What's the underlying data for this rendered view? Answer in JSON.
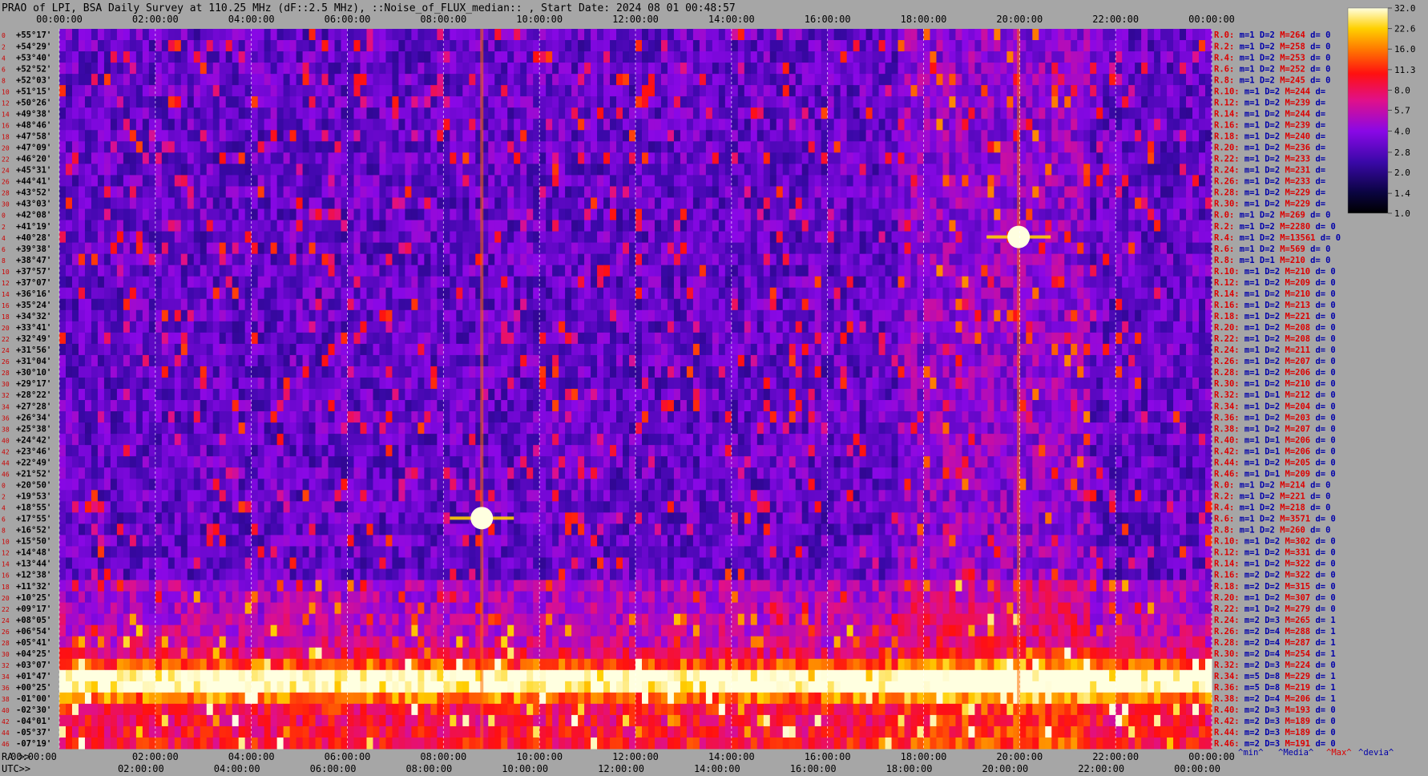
{
  "chart_data": {
    "type": "heatmap",
    "title": "PRAO of LPI, BSA Daily Survey at 110.25 MHz (dF::2.5 MHz), ::Noise_of_FLUX_median:: , Start Date: 2024 08 01 00:48:57",
    "ra_label": "RA >>",
    "utc_label": "UTC>>",
    "top_ticks": [
      "00:00:00",
      "02:00:00",
      "04:00:00",
      "06:00:00",
      "08:00:00",
      "10:00:00",
      "12:00:00",
      "14:00:00",
      "16:00:00",
      "18:00:00",
      "20:00:00",
      "22:00:00",
      "00:00:00"
    ],
    "ra_ticks": [
      "00:00:00",
      "02:00:00",
      "04:00:00",
      "06:00:00",
      "08:00:00",
      "10:00:00",
      "12:00:00",
      "14:00:00",
      "16:00:00",
      "18:00:00",
      "20:00:00",
      "22:00:00",
      "00:00:00"
    ],
    "utc_ticks": [
      "02:00:00",
      "04:00:00",
      "06:00:00",
      "08:00:00",
      "10:00:00",
      "12:00:00",
      "14:00:00",
      "16:00:00",
      "18:00:00",
      "20:00:00",
      "22:00:00",
      "00:00:00"
    ],
    "declinations": [
      "+55°17'",
      "+54°29'",
      "+53°40'",
      "+52°52'",
      "+52°03'",
      "+51°15'",
      "+50°26'",
      "+49°38'",
      "+48°46'",
      "+47°58'",
      "+47°09'",
      "+46°20'",
      "+45°31'",
      "+44°41'",
      "+43°52'",
      "+43°03'",
      "+42°08'",
      "+41°19'",
      "+40°28'",
      "+39°38'",
      "+38°47'",
      "+37°57'",
      "+37°07'",
      "+36°16'",
      "+35°24'",
      "+34°32'",
      "+33°41'",
      "+32°49'",
      "+31°56'",
      "+31°04'",
      "+30°10'",
      "+29°17'",
      "+28°22'",
      "+27°28'",
      "+26°34'",
      "+25°38'",
      "+24°42'",
      "+23°46'",
      "+22°49'",
      "+21°52'",
      "+20°50'",
      "+19°53'",
      "+18°55'",
      "+17°55'",
      "+16°52'",
      "+15°50'",
      "+14°48'",
      "+13°44'",
      "+12°38'",
      "+11°32'",
      "+10°25'",
      "+09°17'",
      "+08°05'",
      "+06°54'",
      "+05°41'",
      "+04°25'",
      "+03°07'",
      "+01°47'",
      "+00°25'",
      "-01°00'",
      "-02°30'",
      "-04°01'",
      "-05°37'",
      "-07°19'"
    ],
    "row_indices": [
      "0",
      "2",
      "4",
      "6",
      "8",
      "10",
      "12",
      "14",
      "16",
      "18",
      "20",
      "22",
      "24",
      "26",
      "28",
      "30",
      "0",
      "2",
      "4",
      "6",
      "8",
      "10",
      "12",
      "14",
      "16",
      "18",
      "20",
      "22",
      "24",
      "26",
      "28",
      "30",
      "32",
      "34",
      "36",
      "38",
      "40",
      "42",
      "44",
      "46",
      "0",
      "2",
      "4",
      "6",
      "8",
      "10",
      "12",
      "14",
      "16",
      "18",
      "20",
      "22",
      "24",
      "26",
      "28",
      "30",
      "32",
      "34",
      "36",
      "38",
      "40",
      "42",
      "44",
      "46"
    ],
    "stats": [
      {
        "r": "R.0:",
        "m": "m=1",
        "d": "D=2",
        "M": "M=264",
        "dev": "d= 0"
      },
      {
        "r": "R.2:",
        "m": "m=1",
        "d": "D=2",
        "M": "M=258",
        "dev": "d= 0"
      },
      {
        "r": "R.4:",
        "m": "m=1",
        "d": "D=2",
        "M": "M=253",
        "dev": "d= 0"
      },
      {
        "r": "R.6:",
        "m": "m=1",
        "d": "D=2",
        "M": "M=252",
        "dev": "d= 0"
      },
      {
        "r": "R.8:",
        "m": "m=1",
        "d": "D=2",
        "M": "M=245",
        "dev": "d= 0"
      },
      {
        "r": "R.10:",
        "m": "m=1",
        "d": "D=2",
        "M": "M=244",
        "dev": "d="
      },
      {
        "r": "R.12:",
        "m": "m=1",
        "d": "D=2",
        "M": "M=239",
        "dev": "d="
      },
      {
        "r": "R.14:",
        "m": "m=1",
        "d": "D=2",
        "M": "M=244",
        "dev": "d="
      },
      {
        "r": "R.16:",
        "m": "m=1",
        "d": "D=2",
        "M": "M=239",
        "dev": "d="
      },
      {
        "r": "R.18:",
        "m": "m=1",
        "d": "D=2",
        "M": "M=240",
        "dev": "d="
      },
      {
        "r": "R.20:",
        "m": "m=1",
        "d": "D=2",
        "M": "M=236",
        "dev": "d="
      },
      {
        "r": "R.22:",
        "m": "m=1",
        "d": "D=2",
        "M": "M=233",
        "dev": "d="
      },
      {
        "r": "R.24:",
        "m": "m=1",
        "d": "D=2",
        "M": "M=231",
        "dev": "d="
      },
      {
        "r": "R.26:",
        "m": "m=1",
        "d": "D=2",
        "M": "M=233",
        "dev": "d="
      },
      {
        "r": "R.28:",
        "m": "m=1",
        "d": "D=2",
        "M": "M=229",
        "dev": "d="
      },
      {
        "r": "R.30:",
        "m": "m=1",
        "d": "D=2",
        "M": "M=229",
        "dev": "d="
      },
      {
        "r": "R.0:",
        "m": "m=1",
        "d": "D=2",
        "M": "M=269",
        "dev": "d= 0"
      },
      {
        "r": "R.2:",
        "m": "m=1",
        "d": "D=2",
        "M": "M=2280",
        "dev": "d= 0"
      },
      {
        "r": "R.4:",
        "m": "m=1",
        "d": "D=2",
        "M": "M=13561",
        "dev": "d= 0"
      },
      {
        "r": "R.6:",
        "m": "m=1",
        "d": "D=2",
        "M": "M=569",
        "dev": "d= 0"
      },
      {
        "r": "R.8:",
        "m": "m=1",
        "d": "D=1",
        "M": "M=210",
        "dev": "d= 0"
      },
      {
        "r": "R.10:",
        "m": "m=1",
        "d": "D=2",
        "M": "M=210",
        "dev": "d= 0"
      },
      {
        "r": "R.12:",
        "m": "m=1",
        "d": "D=2",
        "M": "M=209",
        "dev": "d= 0"
      },
      {
        "r": "R.14:",
        "m": "m=1",
        "d": "D=2",
        "M": "M=210",
        "dev": "d= 0"
      },
      {
        "r": "R.16:",
        "m": "m=1",
        "d": "D=2",
        "M": "M=213",
        "dev": "d= 0"
      },
      {
        "r": "R.18:",
        "m": "m=1",
        "d": "D=2",
        "M": "M=221",
        "dev": "d= 0"
      },
      {
        "r": "R.20:",
        "m": "m=1",
        "d": "D=2",
        "M": "M=208",
        "dev": "d= 0"
      },
      {
        "r": "R.22:",
        "m": "m=1",
        "d": "D=2",
        "M": "M=208",
        "dev": "d= 0"
      },
      {
        "r": "R.24:",
        "m": "m=1",
        "d": "D=2",
        "M": "M=211",
        "dev": "d= 0"
      },
      {
        "r": "R.26:",
        "m": "m=1",
        "d": "D=2",
        "M": "M=207",
        "dev": "d= 0"
      },
      {
        "r": "R.28:",
        "m": "m=1",
        "d": "D=2",
        "M": "M=206",
        "dev": "d= 0"
      },
      {
        "r": "R.30:",
        "m": "m=1",
        "d": "D=2",
        "M": "M=210",
        "dev": "d= 0"
      },
      {
        "r": "R.32:",
        "m": "m=1",
        "d": "D=1",
        "M": "M=212",
        "dev": "d= 0"
      },
      {
        "r": "R.34:",
        "m": "m=1",
        "d": "D=2",
        "M": "M=204",
        "dev": "d= 0"
      },
      {
        "r": "R.36:",
        "m": "m=1",
        "d": "D=2",
        "M": "M=203",
        "dev": "d= 0"
      },
      {
        "r": "R.38:",
        "m": "m=1",
        "d": "D=2",
        "M": "M=207",
        "dev": "d= 0"
      },
      {
        "r": "R.40:",
        "m": "m=1",
        "d": "D=1",
        "M": "M=206",
        "dev": "d= 0"
      },
      {
        "r": "R.42:",
        "m": "m=1",
        "d": "D=1",
        "M": "M=206",
        "dev": "d= 0"
      },
      {
        "r": "R.44:",
        "m": "m=1",
        "d": "D=2",
        "M": "M=205",
        "dev": "d= 0"
      },
      {
        "r": "R.46:",
        "m": "m=1",
        "d": "D=1",
        "M": "M=209",
        "dev": "d= 0"
      },
      {
        "r": "R.0:",
        "m": "m=1",
        "d": "D=2",
        "M": "M=214",
        "dev": "d= 0"
      },
      {
        "r": "R.2:",
        "m": "m=1",
        "d": "D=2",
        "M": "M=221",
        "dev": "d= 0"
      },
      {
        "r": "R.4:",
        "m": "m=1",
        "d": "D=2",
        "M": "M=218",
        "dev": "d= 0"
      },
      {
        "r": "R.6:",
        "m": "m=1",
        "d": "D=2",
        "M": "M=3571",
        "dev": "d= 0"
      },
      {
        "r": "R.8:",
        "m": "m=1",
        "d": "D=2",
        "M": "M=260",
        "dev": "d= 0"
      },
      {
        "r": "R.10:",
        "m": "m=1",
        "d": "D=2",
        "M": "M=302",
        "dev": "d= 0"
      },
      {
        "r": "R.12:",
        "m": "m=1",
        "d": "D=2",
        "M": "M=331",
        "dev": "d= 0"
      },
      {
        "r": "R.14:",
        "m": "m=1",
        "d": "D=2",
        "M": "M=322",
        "dev": "d= 0"
      },
      {
        "r": "R.16:",
        "m": "m=2",
        "d": "D=2",
        "M": "M=322",
        "dev": "d= 0"
      },
      {
        "r": "R.18:",
        "m": "m=2",
        "d": "D=2",
        "M": "M=315",
        "dev": "d= 0"
      },
      {
        "r": "R.20:",
        "m": "m=1",
        "d": "D=2",
        "M": "M=307",
        "dev": "d= 0"
      },
      {
        "r": "R.22:",
        "m": "m=1",
        "d": "D=2",
        "M": "M=279",
        "dev": "d= 0"
      },
      {
        "r": "R.24:",
        "m": "m=2",
        "d": "D=3",
        "M": "M=265",
        "dev": "d= 1"
      },
      {
        "r": "R.26:",
        "m": "m=2",
        "d": "D=4",
        "M": "M=288",
        "dev": "d= 1"
      },
      {
        "r": "R.28:",
        "m": "m=2",
        "d": "D=4",
        "M": "M=287",
        "dev": "d= 1"
      },
      {
        "r": "R.30:",
        "m": "m=2",
        "d": "D=4",
        "M": "M=254",
        "dev": "d= 1"
      },
      {
        "r": "R.32:",
        "m": "m=2",
        "d": "D=3",
        "M": "M=224",
        "dev": "d= 0"
      },
      {
        "r": "R.34:",
        "m": "m=5",
        "d": "D=8",
        "M": "M=229",
        "dev": "d= 1"
      },
      {
        "r": "R.36:",
        "m": "m=5",
        "d": "D=8",
        "M": "M=219",
        "dev": "d= 1"
      },
      {
        "r": "R.38:",
        "m": "m=2",
        "d": "D=4",
        "M": "M=206",
        "dev": "d= 1"
      },
      {
        "r": "R.40:",
        "m": "m=2",
        "d": "D=3",
        "M": "M=193",
        "dev": "d= 0"
      },
      {
        "r": "R.42:",
        "m": "m=2",
        "d": "D=3",
        "M": "M=189",
        "dev": "d= 0"
      },
      {
        "r": "R.44:",
        "m": "m=2",
        "d": "D=3",
        "M": "M=189",
        "dev": "d= 0"
      },
      {
        "r": "R.46:",
        "m": "m=2",
        "d": "D=3",
        "M": "M=191",
        "dev": "d= 0"
      }
    ],
    "stats_footer": [
      "^min^",
      "^Media^",
      "^Max^",
      "^devia^"
    ],
    "colorbar": {
      "ticks": [
        "32.0",
        "22.6",
        "16.0",
        "11.3",
        "8.0",
        "5.7",
        "4.0",
        "2.8",
        "2.0",
        "1.4",
        "1.0"
      ],
      "scale": "log2",
      "range": [
        1.0,
        32.0
      ]
    },
    "colors": {
      "background": "#a6a6a6",
      "title": "#000000",
      "stat_blue": "#0000aa",
      "stat_red": "#dd0000",
      "grid_line": "#ffffff"
    },
    "features": [
      {
        "name": "bright source",
        "ra_hours": 19.98,
        "dec": 40.7
      },
      {
        "name": "bright source",
        "ra_hours": 8.8,
        "dec": 18.0
      },
      {
        "name": "galactic plane band",
        "dec": 1.0
      }
    ]
  }
}
